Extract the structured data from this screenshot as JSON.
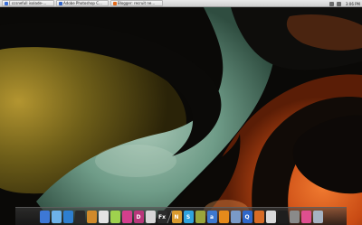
{
  "taskbar": {
    "tasks": [
      {
        "label": "[ ccsnefull isolade-...",
        "color": "#3a6fd8"
      },
      {
        "label": "Adobe Photoshop C...",
        "color": "#3064c8"
      },
      {
        "label": "Blogger: recruit ne...",
        "color": "#e36a1a"
      }
    ],
    "clock": "3:06 PM"
  },
  "wallpaper": {
    "colors": {
      "dark": "#0a0a08",
      "olive": "#6c5e18",
      "gold": "#a78b2a",
      "teal": "#5d8a77",
      "mint": "#8cb3a0",
      "orange": "#d3561a",
      "rust": "#9a3610"
    }
  },
  "dock": {
    "items": [
      {
        "name": "finder-icon",
        "glyph": "",
        "color": "#3d78d6"
      },
      {
        "name": "mail-icon",
        "glyph": "",
        "color": "#6db2e8"
      },
      {
        "name": "chat-icon",
        "glyph": "",
        "color": "#2e7fcf"
      },
      {
        "name": "media-player-icon",
        "glyph": "",
        "color": "#2a2a2a"
      },
      {
        "name": "robot-icon",
        "glyph": "",
        "color": "#d08a2a"
      },
      {
        "name": "document-icon",
        "glyph": "",
        "color": "#e3e3e3"
      },
      {
        "name": "app-icon",
        "glyph": "",
        "color": "#9fd14e"
      },
      {
        "name": "photoshop-icon",
        "glyph": "",
        "color": "#d43f8d"
      },
      {
        "name": "indesign-icon",
        "glyph": "D",
        "color": "#b8377a"
      },
      {
        "name": "illustrator-icon",
        "glyph": "",
        "color": "#d6d6d6"
      },
      {
        "name": "flash-icon",
        "glyph": "Fx",
        "color": "#2b2b2b"
      },
      {
        "name": "separator",
        "glyph": "/",
        "color": "#7a7a7a"
      },
      {
        "name": "notes-icon",
        "glyph": "N",
        "color": "#d99a2f"
      },
      {
        "name": "skype-icon",
        "glyph": "S",
        "color": "#2fa3de"
      },
      {
        "name": "stats-icon",
        "glyph": "",
        "color": "#9aa53b"
      },
      {
        "name": "appstore-icon",
        "glyph": "a",
        "color": "#3e78cf"
      },
      {
        "name": "vlc-icon",
        "glyph": "",
        "color": "#e58a1b"
      },
      {
        "name": "mirror-icon",
        "glyph": "",
        "color": "#7a9ac7"
      },
      {
        "name": "quicktime-icon",
        "glyph": "Q",
        "color": "#2f67c9"
      },
      {
        "name": "firefox-icon",
        "glyph": "",
        "color": "#d76b25"
      },
      {
        "name": "downloads-icon",
        "glyph": "",
        "color": "#d9d9d9"
      },
      {
        "name": "terminal-icon",
        "glyph": "",
        "color": "#1e1e1e"
      },
      {
        "name": "system-icon",
        "glyph": "",
        "color": "#8a8a8a"
      },
      {
        "name": "pink-app-icon",
        "glyph": "",
        "color": "#df4f8f"
      },
      {
        "name": "trash-icon",
        "glyph": "",
        "color": "#a6b3c2"
      }
    ]
  }
}
